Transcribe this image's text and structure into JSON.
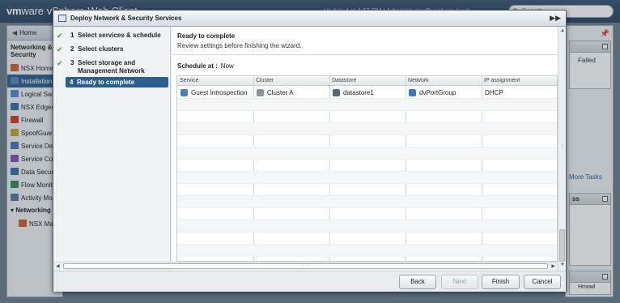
{
  "app": {
    "brand_vm": "vm",
    "brand_ware": "ware",
    "brand_rest": "vSphere Web Client",
    "header_info": "Updated at 4:13 PM | Administrator@vsphere.local",
    "search_placeholder": "Search"
  },
  "left_nav": {
    "home_label": "Home",
    "heading": "Networking & Security",
    "items": [
      {
        "label": "NSX Home",
        "icon": "nsx-home-icon",
        "color": "#d65b2c"
      },
      {
        "label": "Installation",
        "icon": "installation-icon",
        "color": "#5d84b8",
        "selected": true
      },
      {
        "label": "Logical Switches",
        "icon": "logical-switch-icon",
        "color": "#4f8ad1"
      },
      {
        "label": "NSX Edges",
        "icon": "nsx-edge-icon",
        "color": "#3c6ea8"
      },
      {
        "label": "Firewall",
        "icon": "firewall-icon",
        "color": "#d23b2a"
      },
      {
        "label": "SpoofGuard",
        "icon": "spoofguard-icon",
        "color": "#c9a227"
      },
      {
        "label": "Service Definitions",
        "icon": "service-definitions-icon",
        "color": "#4a78b0"
      },
      {
        "label": "Service Composer",
        "icon": "service-composer-icon",
        "color": "#8a4fb0"
      },
      {
        "label": "Data Security",
        "icon": "data-security-icon",
        "color": "#3b6fa8"
      },
      {
        "label": "Flow Monitoring",
        "icon": "flow-monitoring-icon",
        "color": "#2f8a5e"
      },
      {
        "label": "Activity Monitoring",
        "icon": "activity-monitoring-icon",
        "color": "#5a7a9a"
      }
    ],
    "subheading": "Networking & Security Inventory",
    "sub_items": [
      {
        "label": "NSX Managers",
        "icon": "nsx-manager-icon",
        "color": "#d65b2c"
      }
    ]
  },
  "right_panel": {
    "failed_label": "Failed",
    "more_tasks": "More Tasks",
    "box2_title": "ss",
    "bottom_text": "Hmowl"
  },
  "dialog": {
    "title": "Deploy Network & Security Services",
    "steps": [
      {
        "num": "1",
        "label": "Select services & schedule",
        "done": true
      },
      {
        "num": "2",
        "label": "Select clusters",
        "done": true
      },
      {
        "num": "3",
        "label": "Select storage and Management Network",
        "done": true
      },
      {
        "num": "4",
        "label": "Ready to complete",
        "current": true
      }
    ],
    "content_title": "Ready to complete",
    "content_desc": "Review settings before finishing the wizard.",
    "schedule_label": "Schedule at :",
    "schedule_value": "Now",
    "columns": [
      "Service",
      "Cluster",
      "Datastore",
      "Network",
      "IP assignment"
    ],
    "rows": [
      {
        "service": "Guest Introspection",
        "cluster": "Cluster A",
        "datastore": "datastore1",
        "network": "dvPortGroup",
        "ip": "DHCP"
      }
    ],
    "buttons": {
      "back": "Back",
      "next": "Next",
      "finish": "Finish",
      "cancel": "Cancel"
    }
  }
}
